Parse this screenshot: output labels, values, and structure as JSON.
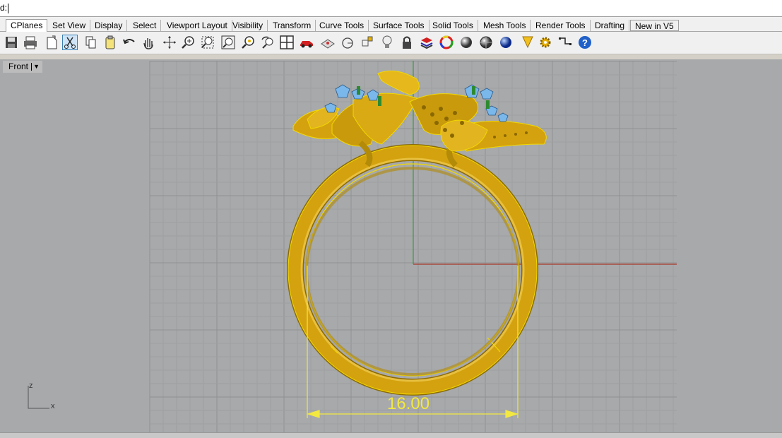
{
  "command": {
    "prompt": "d:"
  },
  "tabs": [
    "CPlanes",
    "Set View",
    "Display",
    "Select",
    "Viewport Layout",
    "Visibility",
    "Transform",
    "Curve Tools",
    "Surface Tools",
    "Solid Tools",
    "Mesh Tools",
    "Render Tools",
    "Drafting",
    "New in V5"
  ],
  "toolbar": {
    "icons": [
      "save-icon",
      "print-icon",
      "import-icon",
      "cut-icon",
      "copy-icon",
      "paste-icon",
      "undo-icon",
      "pan-icon",
      "rotate-view-icon",
      "zoom-icon",
      "zoom-window-icon",
      "zoom-extents-icon",
      "zoom-selected-icon",
      "undo-view-icon",
      "four-viewports-icon",
      "car-icon",
      "plane-icon",
      "circle-icon",
      "point-icon",
      "light-icon",
      "lock-icon",
      "layer-icon",
      "color-wheel-icon",
      "render-sphere-icon",
      "shaded-sphere-icon",
      "blue-sphere-icon",
      "analyze-icon",
      "settings-gear-icon",
      "grid-snap-icon",
      "help-icon"
    ]
  },
  "viewport": {
    "name": "Front",
    "axis_labels": {
      "z": "z",
      "x": "x"
    },
    "dimension": "16.00",
    "colors": {
      "background": "#a7a9ab",
      "grid": "#9c9ea0",
      "gold": "#d4a20e",
      "highlight": "#f5d800",
      "gem": "#7ab7ea"
    }
  }
}
